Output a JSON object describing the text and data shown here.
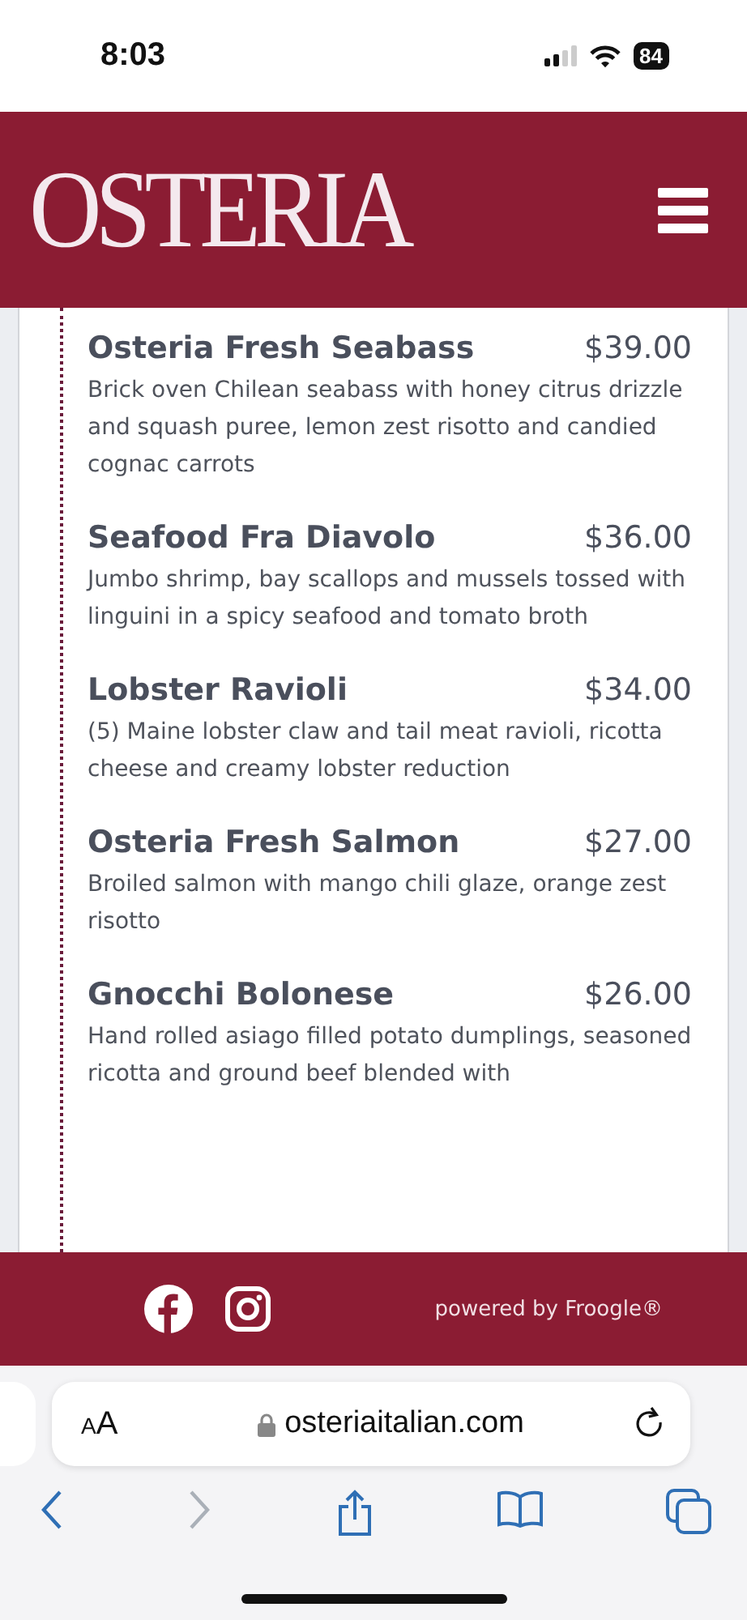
{
  "status_bar": {
    "time": "8:03",
    "battery": "84"
  },
  "header": {
    "logo": "OSTERIA"
  },
  "menu_items": [
    {
      "name": "Osteria Fresh Seabass",
      "price": "$39.00",
      "description": "Brick oven Chilean seabass with honey citrus drizzle and squash puree, lemon zest risotto and candied cognac carrots"
    },
    {
      "name": "Seafood Fra Diavolo",
      "price": "$36.00",
      "description": "Jumbo shrimp, bay scallops and mussels tossed with linguini in a spicy seafood and tomato broth"
    },
    {
      "name": "Lobster Ravioli",
      "price": "$34.00",
      "description": "(5) Maine lobster claw and tail meat ravioli, ricotta cheese and creamy lobster reduction"
    },
    {
      "name": "Osteria Fresh Salmon",
      "price": "$27.00",
      "description": "Broiled salmon with mango chili glaze, orange zest risotto"
    },
    {
      "name": "Gnocchi Bolonese",
      "price": "$26.00",
      "description": "Hand rolled asiago filled potato dumplings, seasoned ricotta and ground beef blended with"
    }
  ],
  "footer": {
    "powered_by": "powered by Froogle®"
  },
  "browser": {
    "text_size": "AA",
    "url": "osteriaitalian.com"
  }
}
